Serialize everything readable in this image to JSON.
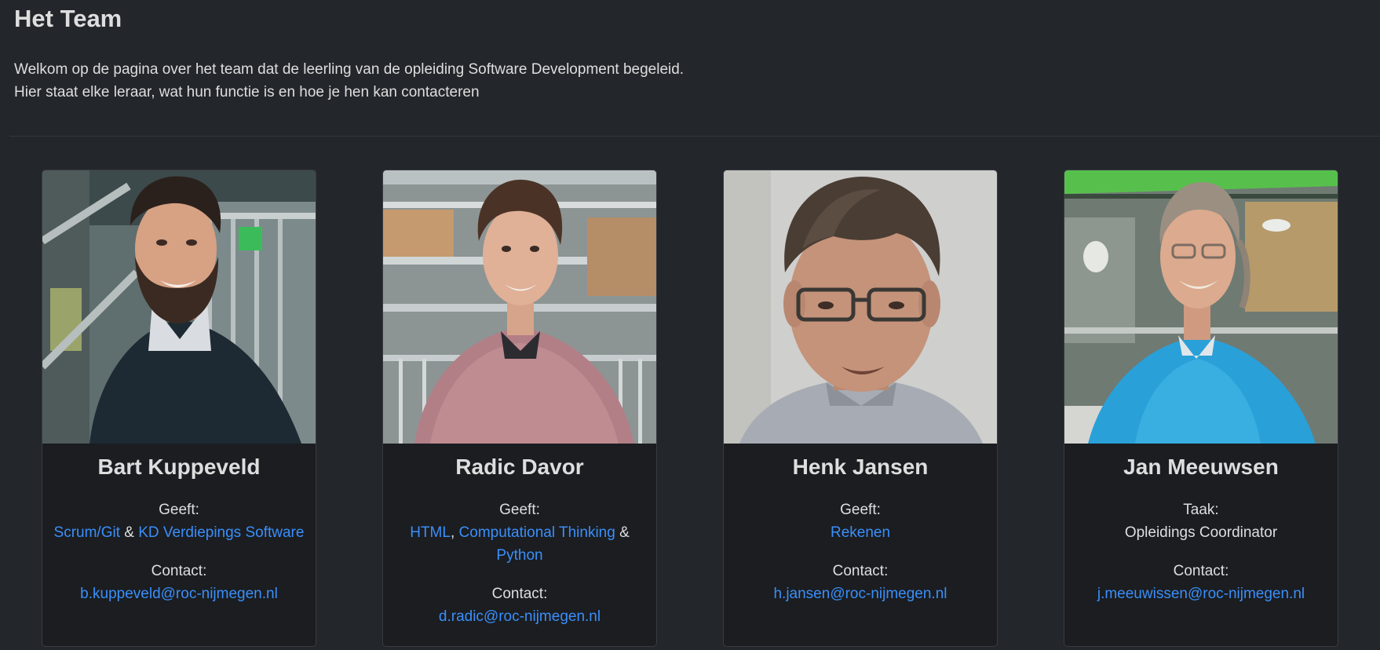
{
  "page": {
    "title": "Het Team",
    "intro_line1": "Welkom op de pagina over het team dat de leerling van de opleiding Software Development begeleid.",
    "intro_line2": "Hier staat elke leraar, wat hun functie is en hoe je hen kan contacteren"
  },
  "colors": {
    "background": "#23262b",
    "card_background": "#1b1d21",
    "link": "#3a8ffa",
    "text": "#dedede"
  },
  "cards": [
    {
      "name": "Bart Kuppeveld",
      "role_label": "Geeft:",
      "courses": [
        "Scrum/Git",
        "KD Verdiepings Software"
      ],
      "separators": [
        " & "
      ],
      "contact_label": "Contact:",
      "email": "b.kuppeveld@roc-nijmegen.nl"
    },
    {
      "name": "Radic Davor",
      "role_label": "Geeft:",
      "courses": [
        "HTML",
        "Computational Thinking",
        "Python"
      ],
      "separators": [
        ", ",
        " & "
      ],
      "contact_label": "Contact:",
      "email": "d.radic@roc-nijmegen.nl"
    },
    {
      "name": "Henk Jansen",
      "role_label": "Geeft:",
      "courses": [
        "Rekenen"
      ],
      "separators": [],
      "contact_label": "Contact:",
      "email": "h.jansen@roc-nijmegen.nl"
    },
    {
      "name": "Jan Meeuwsen",
      "role_label": "Taak:",
      "task": "Opleidings Coordinator",
      "contact_label": "Contact:",
      "email": "j.meeuwissen@roc-nijmegen.nl"
    }
  ]
}
